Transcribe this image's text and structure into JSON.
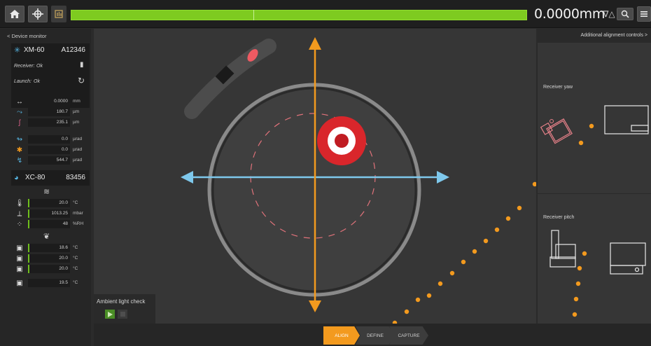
{
  "topbar": {
    "measurement": "0.0000mm",
    "sort_symbol": "∇△"
  },
  "left_panel": {
    "header": "< Device monitor",
    "device1": {
      "model": "XM-60",
      "serial": "A12346",
      "receiver_label": "Receiver:",
      "receiver_status": "Ok",
      "launch_label": "Launch:",
      "launch_status": "Ok",
      "readings": [
        {
          "icon": "↔",
          "value": "0.0000",
          "unit": "mm"
        },
        {
          "icon": "⤳",
          "value": "180.7",
          "unit": "µm"
        },
        {
          "icon": "ʃ",
          "value": "235.1",
          "unit": "µm"
        },
        {
          "icon": "↬",
          "value": "0.0",
          "unit": "µrad"
        },
        {
          "icon": "✱",
          "value": "0.0",
          "unit": "µrad"
        },
        {
          "icon": "↯",
          "value": "544.7",
          "unit": "µrad"
        }
      ]
    },
    "device2": {
      "model": "XC-80",
      "serial": "83456",
      "env_readings": [
        {
          "icon": "🌡",
          "value": "20.0",
          "unit": "°C"
        },
        {
          "icon": "⟂",
          "value": "1013.25",
          "unit": "mbar"
        },
        {
          "icon": "⁘",
          "value": "48",
          "unit": "%RH"
        }
      ],
      "material_readings": [
        {
          "icon": "▣",
          "value": "18.6",
          "unit": "°C"
        },
        {
          "icon": "▣",
          "value": "20.0",
          "unit": "°C"
        },
        {
          "icon": "▣",
          "value": "20.0",
          "unit": "°C"
        },
        {
          "icon": "▣",
          "value": "19.5",
          "unit": "°C"
        }
      ]
    }
  },
  "ambient": {
    "label": "Ambient light check"
  },
  "right_panel": {
    "header": "Additional alignment controls  >",
    "yaw_label": "Receiver yaw",
    "pitch_label": "Receiver pitch"
  },
  "workflow": {
    "steps": [
      "ALIGN",
      "DEFINE",
      "CAPTURE"
    ],
    "active": "ALIGN"
  },
  "colors": {
    "accent_orange": "#f39a1e",
    "meter_green": "#7ecb20",
    "axis_blue": "#7ec8ec",
    "target_red": "#d9262b"
  }
}
